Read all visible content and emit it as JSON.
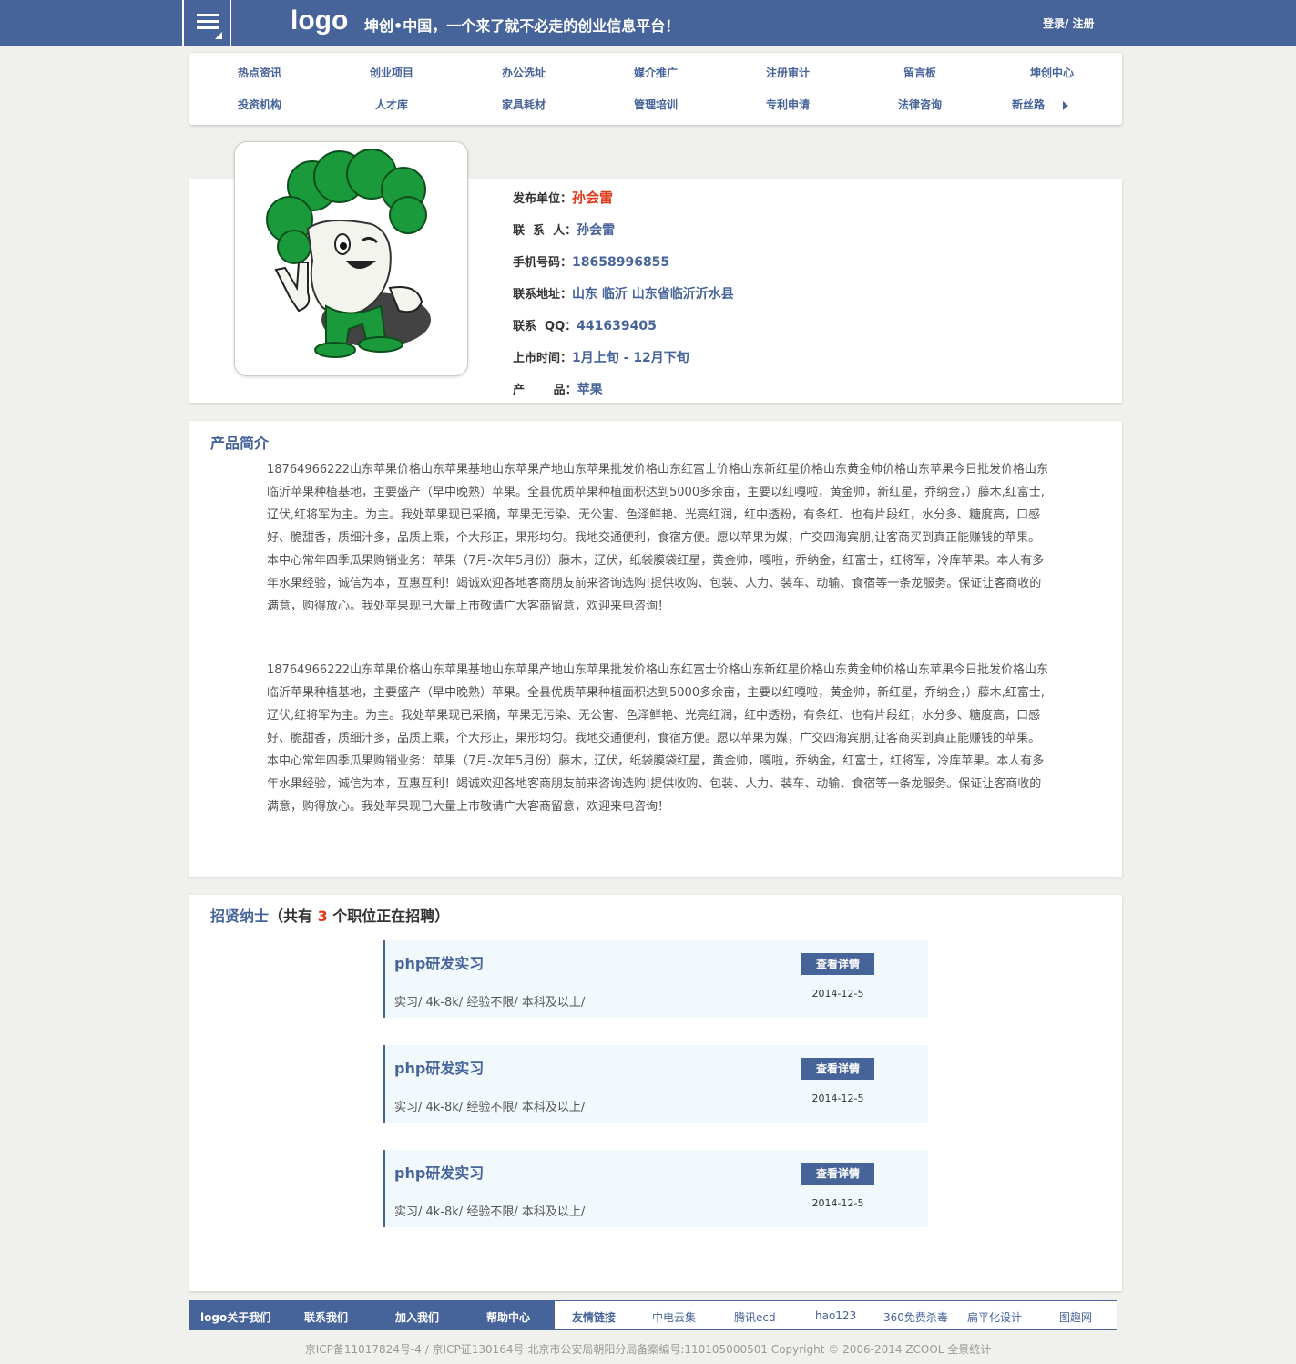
{
  "header": {
    "logo": "logo",
    "slogan": "坤创•中国，一个来了就不必走的创业信息平台！",
    "auth": "登录/ 注册"
  },
  "nav": {
    "row1": [
      "热点资讯",
      "创业项目",
      "办公选址",
      "媒介推广",
      "注册审计",
      "留言板",
      "坤创中心"
    ],
    "row2": [
      "投资机构",
      "人才库",
      "家具耗材",
      "管理培训",
      "专利申请",
      "法律咨询",
      "新丝路"
    ]
  },
  "profile": {
    "avatar_icon": "broccoli-mascot-icon",
    "rows": [
      {
        "label": "发布单位：",
        "value": "孙会雷"
      },
      {
        "label": "联  系  人：",
        "value": "孙会雷"
      },
      {
        "label": "手机号码：",
        "value": "18658996855"
      },
      {
        "label": "联系地址：",
        "value": "山东 临沂 山东省临沂沂水县"
      },
      {
        "label": "联系  QQ：",
        "value": "441639405"
      },
      {
        "label": "上市时间：",
        "value": "1月上旬 - 12月下旬"
      },
      {
        "label": "产       品：",
        "value": "苹果"
      }
    ]
  },
  "intro": {
    "title": "产品简介",
    "paragraphs": [
      "18764966222山东苹果价格山东苹果基地山东苹果产地山东苹果批发价格山东红富士价格山东新红星价格山东黄金帅价格山东苹果今日批发价格山东临沂苹果种植基地，主要盛产（早中晚熟）苹果。全县优质苹果种植面积达到5000多余亩，主要以红嘎啦，黄金帅，新红星，乔纳金，）藤木,红富士,辽伏,红将军为主。为主。我处苹果现已采摘，苹果无污染、无公害、色泽鲜艳、光亮红润，红中透粉，有条红、也有片段红，水分多、糖度高，口感好、脆甜香，质细汁多，品质上乘，个大形正，果形均匀。我地交通便利，食宿方便。愿以苹果为媒，广交四海宾朋,让客商买到真正能赚钱的苹果。本中心常年四季瓜果购销业务：苹果（7月-次年5月份）藤木，辽伏，纸袋膜袋红星，黄金帅，嘎啦，乔纳金，红富士，红将军，冷库苹果。本人有多年水果经验，诚信为本，互惠互利！竭诚欢迎各地客商朋友前来咨询选购!提供收购、包装、人力、装车、动输、食宿等一条龙服务。保证让客商收的满意，购得放心。我处苹果现已大量上市敬请广大客商留意，欢迎来电咨询！",
      "18764966222山东苹果价格山东苹果基地山东苹果产地山东苹果批发价格山东红富士价格山东新红星价格山东黄金帅价格山东苹果今日批发价格山东临沂苹果种植基地，主要盛产（早中晚熟）苹果。全县优质苹果种植面积达到5000多余亩，主要以红嘎啦，黄金帅，新红星，乔纳金，）藤木,红富士,辽伏,红将军为主。为主。我处苹果现已采摘，苹果无污染、无公害、色泽鲜艳、光亮红润，红中透粉，有条红、也有片段红，水分多、糖度高，口感好、脆甜香，质细汁多，品质上乘，个大形正，果形均匀。我地交通便利，食宿方便。愿以苹果为媒，广交四海宾朋,让客商买到真正能赚钱的苹果。本中心常年四季瓜果购销业务：苹果（7月-次年5月份）藤木，辽伏，纸袋膜袋红星，黄金帅，嘎啦，乔纳金，红富士，红将军，冷库苹果。本人有多年水果经验，诚信为本，互惠互利！竭诚欢迎各地客商朋友前来咨询选购!提供收购、包装、人力、装车、动输、食宿等一条龙服务。保证让客商收的满意，购得放心。我处苹果现已大量上市敬请广大客商留意，欢迎来电咨询！"
    ]
  },
  "jobs": {
    "title": "招贤纳士",
    "count_prefix": "（共有 ",
    "count": "3",
    "count_suffix": " 个职位正在招聘）",
    "items": [
      {
        "title": "php研发实习",
        "meta": "实习/ 4k-8k/ 经验不限/ 本科及以上/",
        "button": "查看详情",
        "date": "2014-12-5"
      },
      {
        "title": "php研发实习",
        "meta": "实习/ 4k-8k/ 经验不限/ 本科及以上/",
        "button": "查看详情",
        "date": "2014-12-5"
      },
      {
        "title": "php研发实习",
        "meta": "实习/ 4k-8k/ 经验不限/ 本科及以上/",
        "button": "查看详情",
        "date": "2014-12-5"
      }
    ]
  },
  "footer": {
    "left": [
      "logo关于我们",
      "联系我们",
      "加入我们",
      "帮助中心"
    ],
    "links_label": "友情链接",
    "links": [
      "中电云集",
      "腾讯ecd",
      "hao123",
      "360免费杀毒",
      "扁平化设计",
      "图趣网"
    ],
    "copyright": "京ICP备11017824号-4 / 京ICP证130164号 北京市公安局朝阳分局备案编号:110105000501 Copyright © 2006-2014 ZCOOL 全景统计"
  },
  "colors": {
    "primary": "#46649a",
    "accent_red": "#e03a1e",
    "job_bg": "#f2f9fd",
    "page_bg": "#f0f0ec"
  }
}
